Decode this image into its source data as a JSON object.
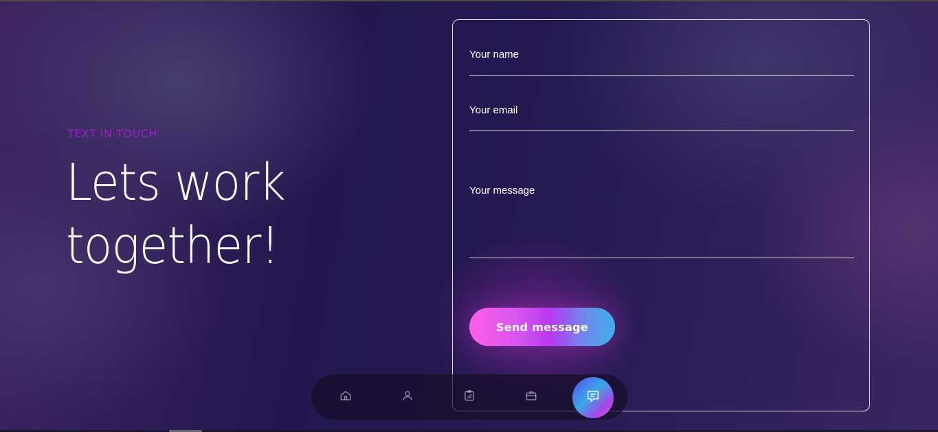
{
  "hero": {
    "eyebrow": "TEXT IN TOUCH",
    "headline": "Lets work together!"
  },
  "form": {
    "name_label": "Your name",
    "email_label": "Your email",
    "message_label": "Your message",
    "send_label": "Send message"
  },
  "dock": {
    "items": [
      {
        "icon": "home-icon"
      },
      {
        "icon": "user-icon"
      },
      {
        "icon": "clipboard-chart-icon"
      },
      {
        "icon": "briefcase-icon"
      },
      {
        "icon": "chat-icon",
        "active": true
      }
    ]
  },
  "colors": {
    "accent_eyebrow": "#9b1ec9",
    "button_gradient_start": "#ff5fe8",
    "button_gradient_end": "#3fb0e6"
  }
}
